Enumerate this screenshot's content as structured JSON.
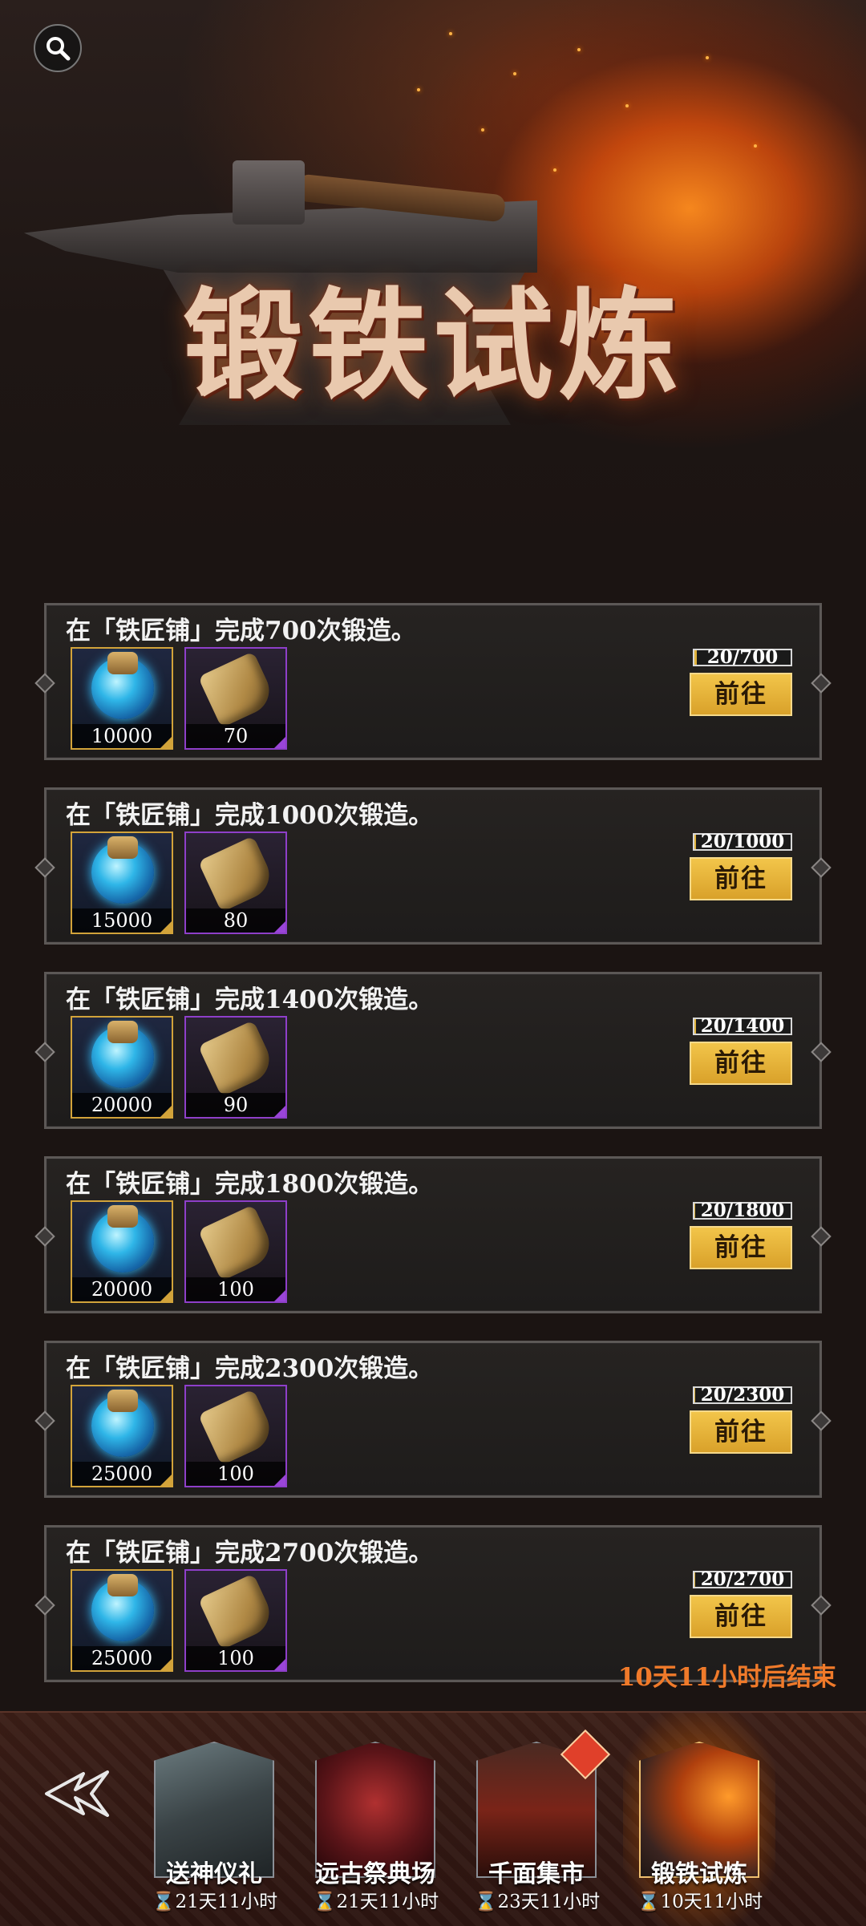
{
  "banner": {
    "title": "锻铁试炼",
    "search_icon": "search-icon"
  },
  "tasks": [
    {
      "desc": "在「铁匠铺」完成700次锻造。",
      "reward1_qty": "10000",
      "reward2_qty": "70",
      "progress_text": "20/700",
      "progress_value": 0.0286,
      "button_label": "前往"
    },
    {
      "desc": "在「铁匠铺」完成1000次锻造。",
      "reward1_qty": "15000",
      "reward2_qty": "80",
      "progress_text": "20/1000",
      "progress_value": 0.02,
      "button_label": "前往"
    },
    {
      "desc": "在「铁匠铺」完成1400次锻造。",
      "reward1_qty": "20000",
      "reward2_qty": "90",
      "progress_text": "20/1400",
      "progress_value": 0.0143,
      "button_label": "前往"
    },
    {
      "desc": "在「铁匠铺」完成1800次锻造。",
      "reward1_qty": "20000",
      "reward2_qty": "100",
      "progress_text": "20/1800",
      "progress_value": 0.0111,
      "button_label": "前往"
    },
    {
      "desc": "在「铁匠铺」完成2300次锻造。",
      "reward1_qty": "25000",
      "reward2_qty": "100",
      "progress_text": "20/2300",
      "progress_value": 0.0087,
      "button_label": "前往"
    },
    {
      "desc": "在「铁匠铺」完成2700次锻造。",
      "reward1_qty": "25000",
      "reward2_qty": "100",
      "progress_text": "20/2700",
      "progress_value": 0.0074,
      "button_label": "前往"
    }
  ],
  "end_timer": "10天11小时后结束",
  "bottom_bar": {
    "back_icon": "back-arrow-icon",
    "events": [
      {
        "name": "送神仪礼",
        "time": "⌛21天11小时",
        "active": false
      },
      {
        "name": "远古祭典场",
        "time": "⌛21天11小时",
        "active": false
      },
      {
        "name": "千面集市",
        "time": "⌛23天11小时",
        "active": false,
        "badge": true
      },
      {
        "name": "锻铁试炼",
        "time": "⌛10天11小时",
        "active": true
      }
    ]
  },
  "colors": {
    "gold_border": "#d2a33a",
    "purple_border": "#8e3fc9",
    "button_gold": "#e0b23c",
    "timer_orange": "#f07a2a"
  }
}
